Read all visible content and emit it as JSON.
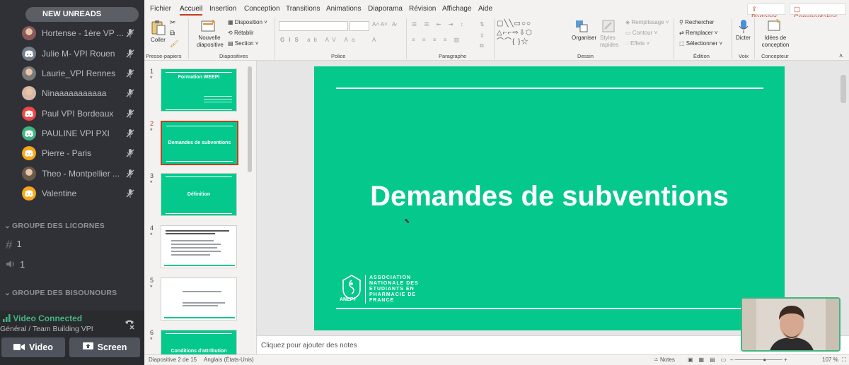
{
  "discord": {
    "new_unreads": "NEW UNREADS",
    "users": [
      {
        "name": "Hortense - 1ère VP ...",
        "avatar_color": "#8a5a5a",
        "photo": true
      },
      {
        "name": "Julie M- VPI Rouen",
        "avatar_color": "#747f8d",
        "photo": false
      },
      {
        "name": "Laurie_VPI Rennes",
        "avatar_color": "#7a7a7a",
        "photo": true
      },
      {
        "name": "Ninaaaaaaaaaaa",
        "avatar_color": "#d8b8a8",
        "photo": true
      },
      {
        "name": "Paul VPI Bordeaux",
        "avatar_color": "#f04747",
        "photo": false
      },
      {
        "name": "PAULINE VPI PXI",
        "avatar_color": "#43b581",
        "photo": false
      },
      {
        "name": "Pierre - Paris",
        "avatar_color": "#faa61a",
        "photo": false
      },
      {
        "name": "Theo - Montpellier ...",
        "avatar_color": "#6b5a4a",
        "photo": true
      },
      {
        "name": "Valentine",
        "avatar_color": "#faa61a",
        "photo": false
      }
    ],
    "categories": [
      {
        "name": "GROUPE DES LICORNES"
      },
      {
        "name": "GROUPE DES BISOUNOURS"
      }
    ],
    "channels": [
      {
        "symbol": "#",
        "name": "1"
      },
      {
        "symbol": "🔊",
        "name": "1"
      }
    ],
    "voice": {
      "status": "Video Connected",
      "location": "Général / Team Building VPI"
    },
    "buttons": {
      "video": "Video",
      "screen": "Screen"
    },
    "colors": {
      "bg": "#2f3136",
      "green": "#43b581"
    }
  },
  "powerpoint": {
    "menu": [
      "Fichier",
      "Accueil",
      "Insertion",
      "Conception",
      "Transitions",
      "Animations",
      "Diaporama",
      "Révision",
      "Affichage",
      "Aide"
    ],
    "active_tab": "Accueil",
    "share": "Partager",
    "comments": "Commentaires",
    "ribbon": {
      "coller": "Coller",
      "nouvelle_diapositive": "Nouvelle diapositive",
      "disposition": "Disposition",
      "retablir": "Rétablir",
      "section": "Section",
      "organiser": "Organiser",
      "styles_rapides": "Styles rapides",
      "remplissage": "Remplissage",
      "contour": "Contour",
      "effets": "Effets",
      "rechercher": "Rechercher",
      "remplacer": "Remplacer",
      "selectionner": "Sélectionner",
      "dicter": "Dicter",
      "idees": "Idées de conception",
      "groups": {
        "presse_papiers": "Presse-papiers",
        "diapositives": "Diapositives",
        "police": "Police",
        "paragraphe": "Paragraphe",
        "dessin": "Dessin",
        "edition": "Édition",
        "voix": "Voix",
        "concepteur": "Concepteur"
      }
    },
    "thumbnails": [
      {
        "num": "1",
        "title": "Formation WEEPI",
        "green": true
      },
      {
        "num": "2",
        "title": "Demandes de subventions",
        "green": true,
        "selected": true
      },
      {
        "num": "3",
        "title": "Définition",
        "green": true
      },
      {
        "num": "4",
        "title": "",
        "green": false
      },
      {
        "num": "5",
        "title": "",
        "green": false
      },
      {
        "num": "6",
        "title": "Conditions d'attribution",
        "green": true
      }
    ],
    "slide": {
      "title": "Demandes de subventions",
      "logo_name": "ANEPF",
      "logo_text": "ASSOCIATION NATIONALE DES ETUDIANTS EN PHARMACIE DE FRANCE",
      "bg_color": "#05c88c"
    },
    "notes_placeholder": "Cliquez pour ajouter des notes",
    "status": {
      "slide_counter": "Diapositive 2 de 15",
      "language": "Anglais (États-Unis)",
      "notes": "Notes",
      "zoom": "107 %"
    }
  }
}
